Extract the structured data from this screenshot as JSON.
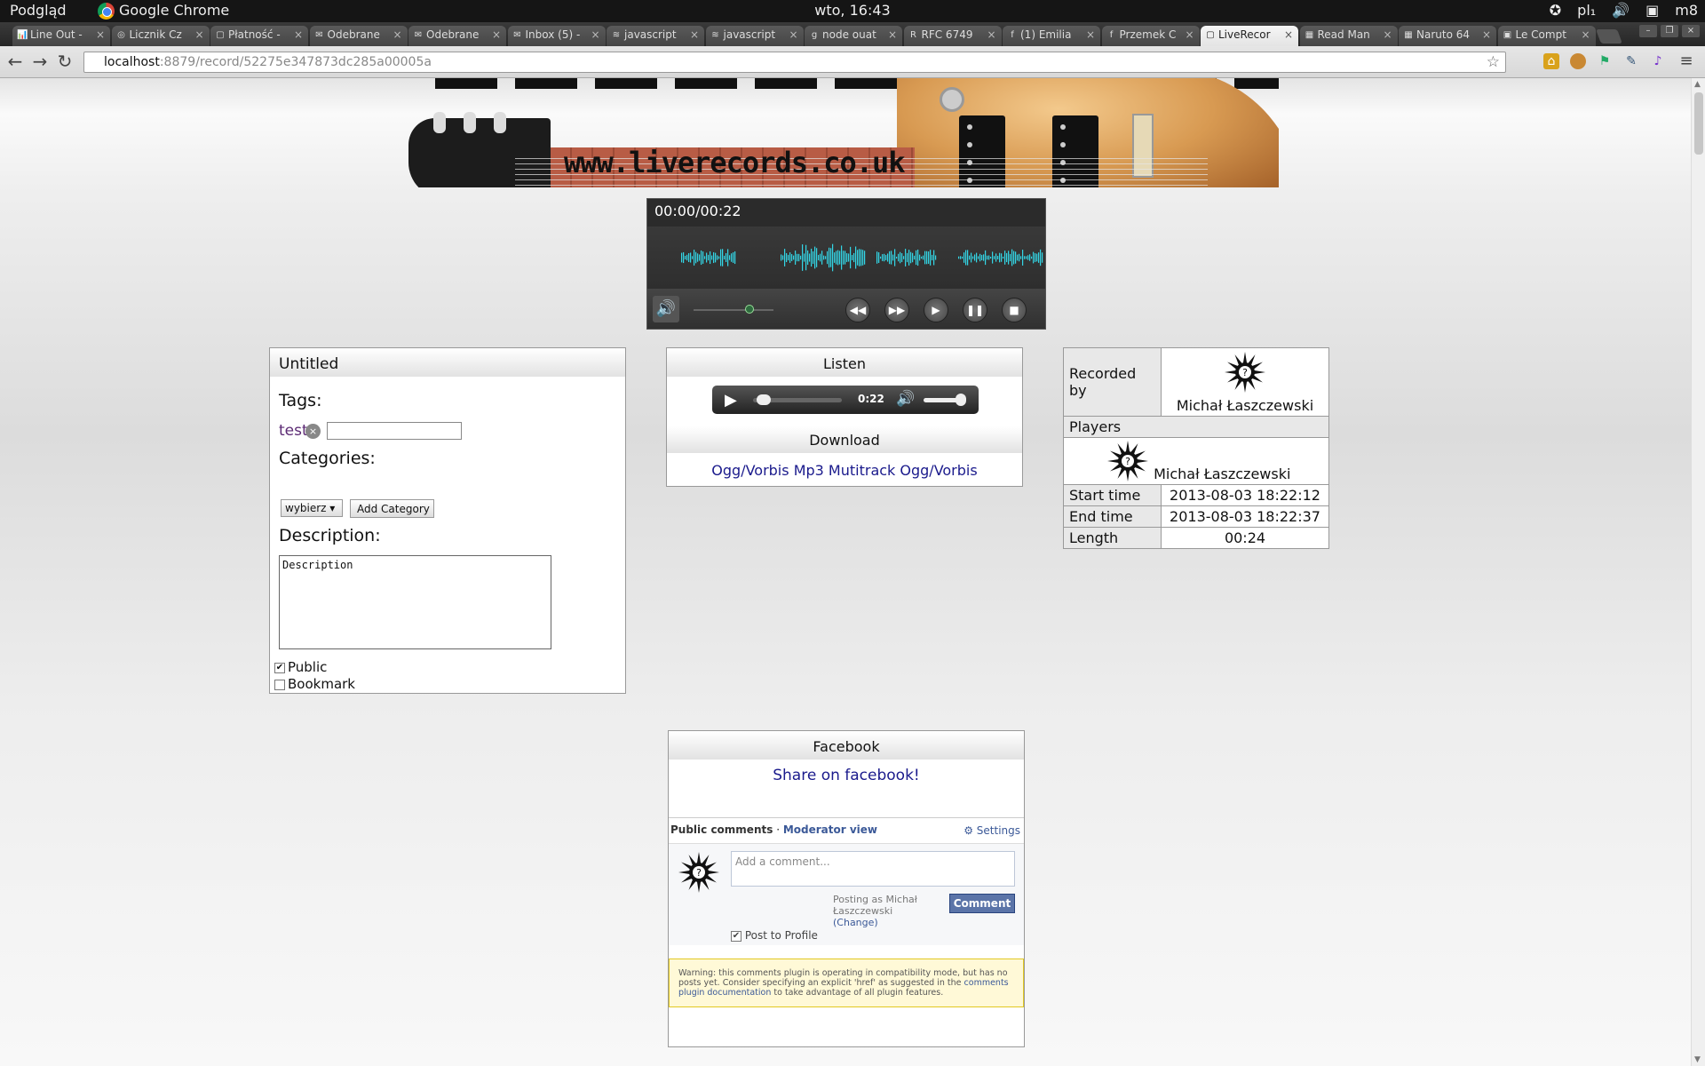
{
  "system": {
    "left_label": "Podgląd",
    "app_label": "Google Chrome",
    "clock": "wto, 16:43",
    "tray": {
      "lang": "pl₁",
      "user": "m8"
    }
  },
  "tabs": [
    "Line Out -",
    "Licznik Cz",
    "Płatność -",
    "Odebrane",
    "Odebrane",
    "Inbox (5) -",
    "javascript",
    "javascript",
    "node ouat",
    "RFC 6749",
    "(1) Emilia",
    "Przemek C",
    "LiveRecor",
    "Read Man",
    "Naruto 64",
    "Le Compt"
  ],
  "active_tab_index": 12,
  "omnibox": {
    "host": "localhost",
    "path": ":8879/record/52275e347873dc285a00005a"
  },
  "banner": {
    "url_text": "www.liverecords.co.uk"
  },
  "player": {
    "time": "00:00/00:22",
    "volume_level": 0.6
  },
  "record": {
    "title": "Untitled",
    "tags_label": "Tags:",
    "tags": [
      "test"
    ],
    "categories_label": "Categories:",
    "category_select": "wybierz",
    "add_category": "Add Category",
    "description_label": "Description:",
    "description_value": "Description",
    "public_label": "Public",
    "public_checked": true,
    "bookmark_label": "Bookmark",
    "bookmark_checked": false
  },
  "listen": {
    "header": "Listen",
    "mini_time": "0:22",
    "download_header": "Download",
    "links": [
      "Ogg/Vorbis",
      "Mp3",
      "Mutitrack Ogg/Vorbis"
    ]
  },
  "info": {
    "recorded_by_label": "Recorded by",
    "recorded_by": "Michał Łaszczewski",
    "players_label": "Players",
    "player_name": "Michał Łaszczewski",
    "start_label": "Start time",
    "start": "2013-08-03 18:22:12",
    "end_label": "End time",
    "end": "2013-08-03 18:22:37",
    "length_label": "Length",
    "length": "00:24"
  },
  "facebook": {
    "header": "Facebook",
    "share": "Share on facebook!",
    "tab_public": "Public comments",
    "tab_moderator": "Moderator view",
    "settings": "Settings",
    "placeholder": "Add a comment...",
    "posting_as": "Posting as Michał Łaszczewski",
    "change": "(Change)",
    "comment_button": "Comment",
    "post_to_profile": "Post to Profile",
    "warning": "Warning: this comments plugin is operating in compatibility mode, but has no posts yet. Consider specifying an explicit 'href' as suggested in the",
    "warning_link": "comments plugin documentation",
    "warning_tail": "to take advantage of all plugin features."
  },
  "colors": {
    "link": "#1a1a8c",
    "fb_blue": "#3b5998",
    "wave": "#33d6e6"
  }
}
